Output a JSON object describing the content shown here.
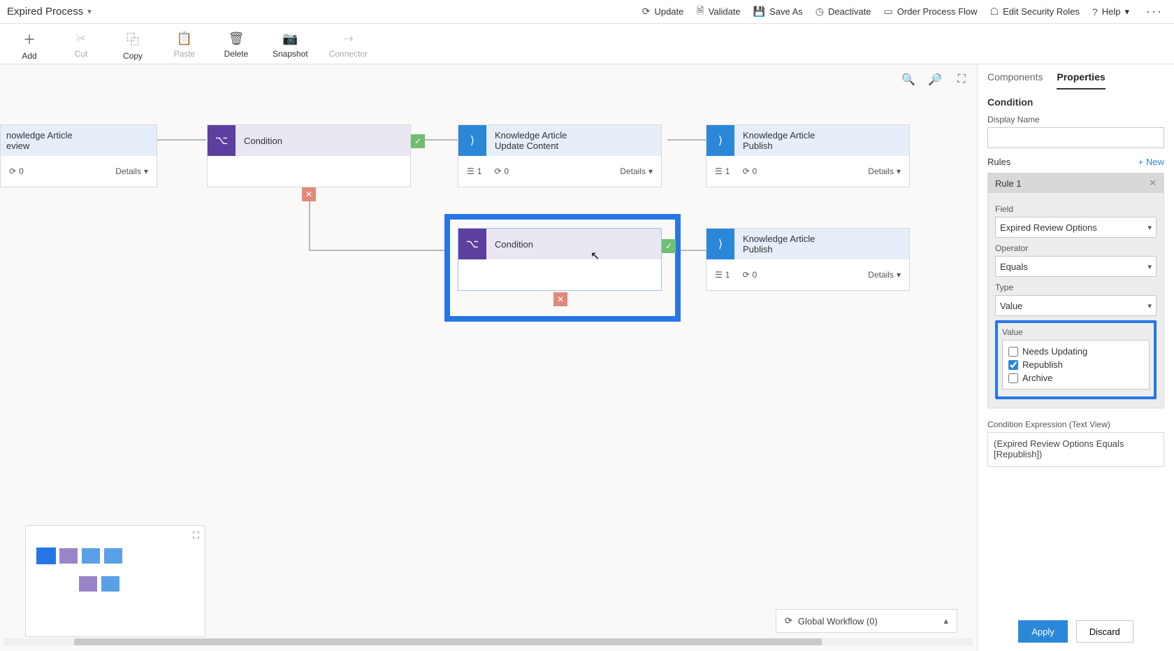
{
  "title": "Expired Process",
  "topbar_actions": {
    "update": "Update",
    "validate": "Validate",
    "save_as": "Save As",
    "deactivate": "Deactivate",
    "order": "Order Process Flow",
    "roles": "Edit Security Roles",
    "help": "Help"
  },
  "ribbon": {
    "add": "Add",
    "cut": "Cut",
    "copy": "Copy",
    "paste": "Paste",
    "delete": "Delete",
    "snapshot": "Snapshot",
    "connector": "Connector"
  },
  "details_label": "Details",
  "cards": {
    "review": {
      "title": "nowledge Article\neview",
      "count1": "0"
    },
    "cond1": {
      "title": "Condition"
    },
    "update_content": {
      "title": "Knowledge Article\nUpdate Content",
      "steps": "1",
      "workflows": "0"
    },
    "publish1": {
      "title": "Knowledge Article\nPublish",
      "steps": "1",
      "workflows": "0"
    },
    "cond2": {
      "title": "Condition"
    },
    "publish2": {
      "title": "Knowledge Article\nPublish",
      "steps": "1",
      "workflows": "0"
    }
  },
  "global_workflow": "Global Workflow (0)",
  "side": {
    "tabs": {
      "components": "Components",
      "properties": "Properties"
    },
    "heading": "Condition",
    "display_name_label": "Display Name",
    "display_name_value": "",
    "rules_label": "Rules",
    "new_label": "+ New",
    "rule1_title": "Rule 1",
    "field_label": "Field",
    "field_value": "Expired Review Options",
    "operator_label": "Operator",
    "operator_value": "Equals",
    "type_label": "Type",
    "type_value": "Value",
    "value_label": "Value",
    "value_options": {
      "needs_updating": "Needs Updating",
      "republish": "Republish",
      "archive": "Archive"
    },
    "expr_label": "Condition Expression (Text View)",
    "expr_value": "(Expired Review Options Equals [Republish])",
    "apply": "Apply",
    "discard": "Discard"
  }
}
